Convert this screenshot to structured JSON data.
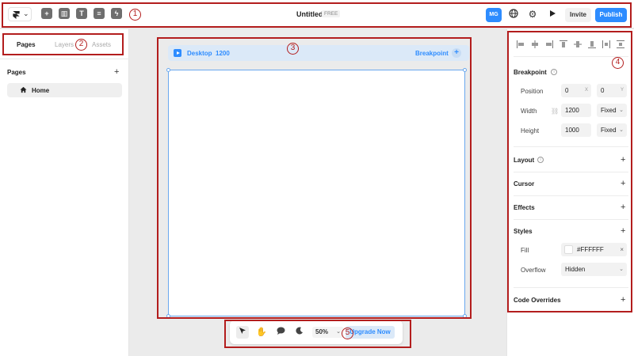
{
  "topbar": {
    "title": "Untitled",
    "plan_badge": "FREE",
    "avatar_initials": "MG",
    "invite_label": "Invite",
    "publish_label": "Publish",
    "tools": [
      "insert-icon",
      "layout-icon",
      "text-icon",
      "cms-icon",
      "plugins-icon"
    ]
  },
  "left_panel": {
    "tabs": [
      {
        "label": "Pages",
        "active": true
      },
      {
        "label": "Layers",
        "active": false
      },
      {
        "label": "Assets",
        "active": false
      }
    ],
    "section_title": "Pages",
    "pages": [
      {
        "label": "Home",
        "icon": "home-icon"
      }
    ]
  },
  "canvas": {
    "breakpoint_name": "Desktop",
    "breakpoint_width": "1200",
    "breakpoint_button": "Breakpoint"
  },
  "bottom_toolbar": {
    "zoom": "50%",
    "upgrade_label": "Upgrade Now"
  },
  "right_panel": {
    "breakpoint_section": "Breakpoint",
    "position_label": "Position",
    "position_x": "0",
    "position_x_suffix": "X",
    "position_y": "0",
    "position_y_suffix": "Y",
    "width_label": "Width",
    "width_value": "1200",
    "width_mode": "Fixed",
    "height_label": "Height",
    "height_value": "1000",
    "height_mode": "Fixed",
    "layout_section": "Layout",
    "cursor_section": "Cursor",
    "effects_section": "Effects",
    "styles_section": "Styles",
    "fill_label": "Fill",
    "fill_value": "#FFFFFF",
    "overflow_label": "Overflow",
    "overflow_value": "Hidden",
    "code_overrides_section": "Code Overrides"
  },
  "annotations": [
    "1",
    "2",
    "3",
    "4",
    "5"
  ],
  "colors": {
    "accent": "#2d8cff",
    "annotation": "#b31d1d",
    "canvas_bg": "#ebebeb"
  }
}
